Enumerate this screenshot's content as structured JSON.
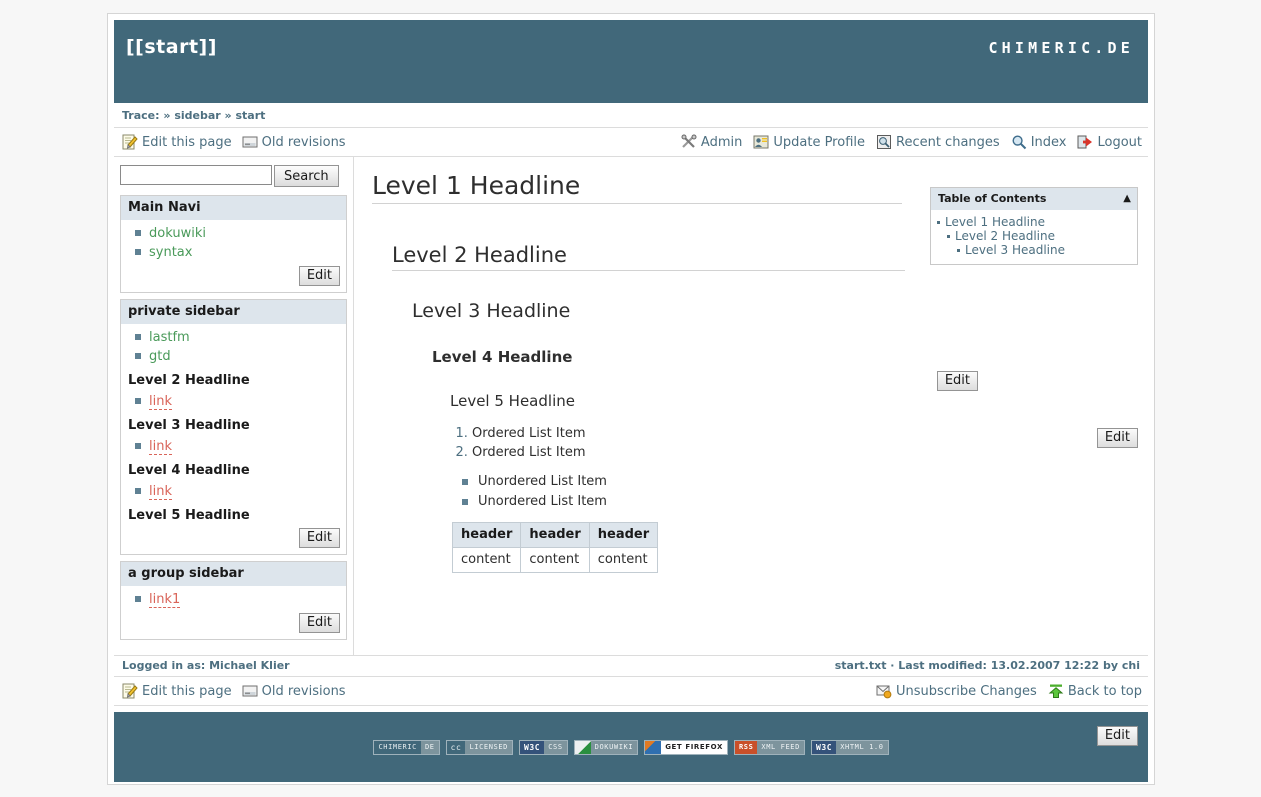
{
  "header": {
    "title": "[[start]]",
    "logo": "CHIMERIC.DE"
  },
  "trace": {
    "label": "Trace:",
    "separator": "»",
    "items": [
      "sidebar",
      "start"
    ]
  },
  "toolbar": {
    "left": [
      {
        "label": "Edit this page",
        "icon": "edit-page-icon"
      },
      {
        "label": "Old revisions",
        "icon": "old-revisions-icon"
      }
    ],
    "right": [
      {
        "label": "Admin",
        "icon": "admin-tools-icon"
      },
      {
        "label": "Update Profile",
        "icon": "update-profile-icon"
      },
      {
        "label": "Recent changes",
        "icon": "recent-changes-icon"
      },
      {
        "label": "Index",
        "icon": "index-magnifier-icon"
      },
      {
        "label": "Logout",
        "icon": "logout-icon"
      }
    ]
  },
  "search": {
    "value": "",
    "placeholder": "",
    "button_label": "Search"
  },
  "sidebar": {
    "edit_label": "Edit",
    "boxes": [
      {
        "title": "Main Navi",
        "links": [
          {
            "label": "dokuwiki",
            "state": "exists"
          },
          {
            "label": "syntax",
            "state": "exists"
          }
        ],
        "sections": []
      },
      {
        "title": "private sidebar",
        "links": [
          {
            "label": "lastfm",
            "state": "exists"
          },
          {
            "label": "gtd",
            "state": "exists"
          }
        ],
        "sections": [
          {
            "heading": "Level 2 Headline",
            "links": [
              {
                "label": "link",
                "state": "missing"
              }
            ]
          },
          {
            "heading": "Level 3 Headline",
            "links": [
              {
                "label": "link",
                "state": "missing"
              }
            ]
          },
          {
            "heading": "Level 4 Headline",
            "links": [
              {
                "label": "link",
                "state": "missing"
              }
            ]
          },
          {
            "heading": "Level 5 Headline",
            "links": []
          }
        ]
      },
      {
        "title": "a group sidebar",
        "links": [
          {
            "label": "link1",
            "state": "missing"
          }
        ],
        "sections": []
      }
    ],
    "logged_in": "Logged in as: Michael Klier"
  },
  "toc": {
    "title": "Table of Contents",
    "toggle_icon": "▲",
    "items": [
      {
        "label": "Level 1 Headline",
        "level": 1
      },
      {
        "label": "Level 2 Headline",
        "level": 2
      },
      {
        "label": "Level 3 Headline",
        "level": 3
      }
    ]
  },
  "content": {
    "edit_label": "Edit",
    "headlines": {
      "h1": "Level 1 Headline",
      "h2": "Level 2 Headline",
      "h3": "Level 3 Headline",
      "h4": "Level 4 Headline",
      "h5": "Level 5 Headline"
    },
    "ordered_list": [
      "Ordered List Item",
      "Ordered List Item"
    ],
    "unordered_list": [
      "Unordered List Item",
      "Unordered List Item"
    ],
    "table": {
      "headers": [
        "header",
        "header",
        "header"
      ],
      "rows": [
        [
          "content",
          "content",
          "content"
        ]
      ]
    }
  },
  "page_meta": {
    "text": "start.txt · Last modified: 13.02.2007 12:22 by chi"
  },
  "footer_bar": {
    "left": [
      {
        "label": "Edit this page",
        "icon": "edit-page-icon"
      },
      {
        "label": "Old revisions",
        "icon": "old-revisions-icon"
      }
    ],
    "right": [
      {
        "label": "Unsubscribe Changes",
        "icon": "unsubscribe-mail-icon"
      },
      {
        "label": "Back to top",
        "icon": "back-to-top-icon"
      }
    ]
  },
  "badges": [
    {
      "name": "chimeric-de-badge",
      "left": "CHIMERIC",
      "right": "DE",
      "style": "text"
    },
    {
      "name": "cc-licensed-badge",
      "left": "cc",
      "right": "LICENSED",
      "style": "cc"
    },
    {
      "name": "w3c-css-badge",
      "left": "W3C",
      "right": "CSS",
      "style": "w3c"
    },
    {
      "name": "dokuwiki-badge",
      "left": "",
      "right": "DOKUWIKI",
      "style": "dokuwiki"
    },
    {
      "name": "get-firefox-badge",
      "left": "",
      "right": "GET FIREFOX",
      "style": "firefox"
    },
    {
      "name": "rss-xml-feed-badge",
      "left": "RSS",
      "right": "XML FEED",
      "style": "rss"
    },
    {
      "name": "w3c-xhtml-badge",
      "left": "W3C",
      "right": "XHTML 1.0",
      "style": "w3c"
    }
  ],
  "colors": {
    "header_bg": "#41687a",
    "box_title_bg": "#dde5ec",
    "link": "#4d6f80",
    "link_exists": "#4a9a5a",
    "link_missing": "#d96459"
  }
}
